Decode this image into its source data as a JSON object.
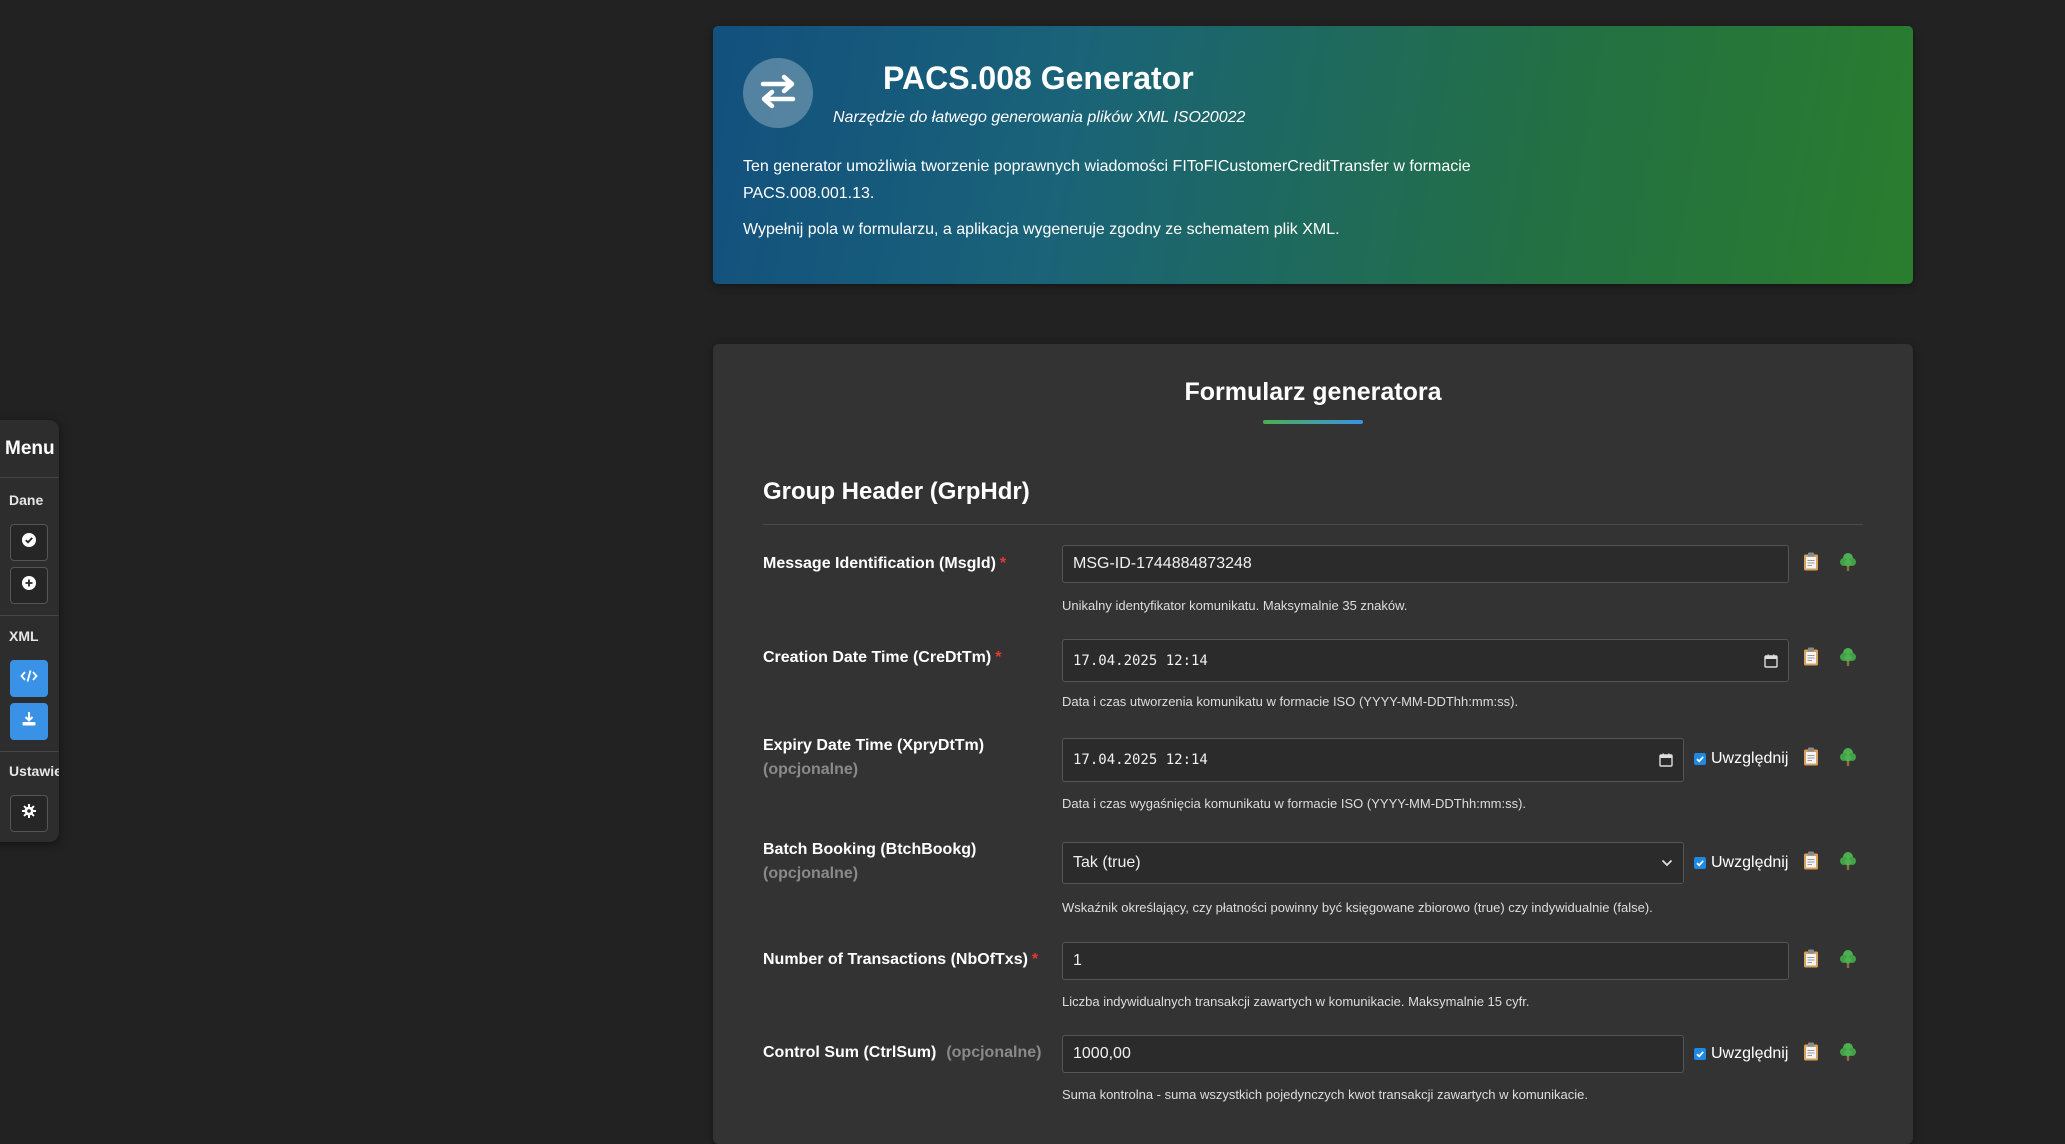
{
  "menu": {
    "title": "Menu",
    "sections": {
      "dane": "Dane",
      "xml": "XML",
      "ustawienia": "Ustawienia"
    }
  },
  "header": {
    "title": "PACS.008 Generator",
    "subtitle": "Narzędzie do łatwego generowania plików XML ISO20022",
    "description_1": "Ten generator umożliwia tworzenie poprawnych wiadomości FIToFICustomerCreditTransfer w formacie PACS.008.001.13.",
    "description_2": "Wypełnij pola w formularzu, a aplikacja wygeneruje zgodny ze schematem plik XML."
  },
  "form": {
    "title": "Formularz generatora",
    "section_title": "Group Header (GrpHdr)",
    "optional_label": "(opcjonalne)",
    "required_marker": "*",
    "include_label": "Uwzględnij",
    "fields": {
      "msg_id": {
        "label": "Message Identification (MsgId)",
        "value": "MSG-ID-1744884873248",
        "help": "Unikalny identyfikator komunikatu. Maksymalnie 35 znaków."
      },
      "cre_dt_tm": {
        "label": "Creation Date Time (CreDtTm)",
        "value": "17.04.2025 12:14",
        "help": "Data i czas utworzenia komunikatu w formacie ISO (YYYY-MM-DDThh:mm:ss)."
      },
      "xpry_dt_tm": {
        "label": "Expiry Date Time (XpryDtTm)",
        "value": "17.04.2025 12:14",
        "include": true,
        "help": "Data i czas wygaśnięcia komunikatu w formacie ISO (YYYY-MM-DDThh:mm:ss)."
      },
      "btch_bookg": {
        "label": "Batch Booking (BtchBookg)",
        "value": "Tak (true)",
        "include": true,
        "help": "Wskaźnik określający, czy płatności powinny być księgowane zbiorowo (true) czy indywidualnie (false)."
      },
      "nb_of_txs": {
        "label": "Number of Transactions (NbOfTxs)",
        "value": "1",
        "help": "Liczba indywidualnych transakcji zawartych w komunikacie. Maksymalnie 15 cyfr."
      },
      "ctrl_sum": {
        "label": "Control Sum (CtrlSum)",
        "value": "1000,00",
        "include": true,
        "help": "Suma kontrolna - suma wszystkich pojedynczych kwot transakcji zawartych w komunikacie."
      }
    }
  },
  "icons": {
    "menu_btn_1": "check-circle-icon",
    "menu_btn_2": "plus-circle-icon",
    "menu_btn_3": "code-icon",
    "menu_btn_4": "download-icon",
    "menu_btn_5": "gear-icon",
    "logo": "exchange-arrows-icon",
    "copy": "clipboard-icon",
    "tree": "tree-icon"
  },
  "colors": {
    "accent_blue": "#3a92e6",
    "required": "#e53935",
    "tree_green": "#4caf50",
    "clipboard": "#d9a05b"
  }
}
